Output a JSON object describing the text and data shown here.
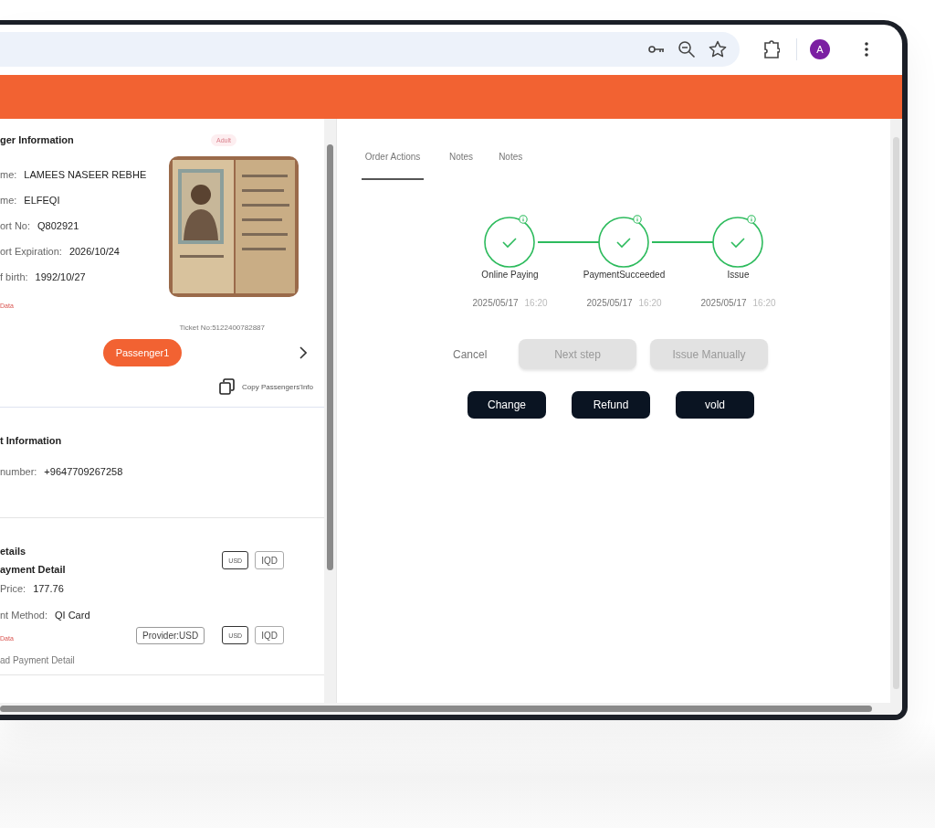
{
  "browser": {
    "avatar": "A"
  },
  "passenger": {
    "title": "ger Information",
    "badge": "Adult",
    "fields": [
      {
        "label": "me:",
        "value": "LAMEES NASEER REBHE"
      },
      {
        "label": "me:",
        "value": "ELFEQI"
      },
      {
        "label": "ort No:",
        "value": "Q802921"
      },
      {
        "label": "ort Expiration:",
        "value": "2026/10/24"
      },
      {
        "label": "f birth:",
        "value": "1992/10/27"
      }
    ],
    "note": "Data",
    "ticket": "Ticket No:5122400782887",
    "button": "Passenger1",
    "copy_label": "Copy Passengers'Info"
  },
  "contact": {
    "title": "t Information",
    "fields": [
      {
        "label": "number:",
        "value": "+9647709267258"
      }
    ]
  },
  "payment": {
    "title": "etails",
    "subtitle": "ayment Detail",
    "currencies": [
      {
        "label": "USD",
        "selected": true
      },
      {
        "label": "IQD",
        "selected": false
      }
    ],
    "fields": [
      {
        "label": "Price:",
        "value": "177.76"
      },
      {
        "label": "nt Method:",
        "value": "QI Card"
      }
    ],
    "note": "Data",
    "provider": "Provider:USD",
    "currencies_2": [
      {
        "label": "USD",
        "selected": true
      },
      {
        "label": "IQD",
        "selected": false
      }
    ],
    "footer": "ad Payment Detail"
  },
  "tabs": [
    {
      "label": "Order Actions",
      "selected": true
    },
    {
      "label": "Notes",
      "selected": false
    },
    {
      "label": "Notes",
      "selected": false
    }
  ],
  "steps": [
    {
      "label": "Online Paying",
      "date": "2025/05/17",
      "time": "16:20",
      "done": true
    },
    {
      "label": "PaymentSucceeded",
      "date": "2025/05/17",
      "time": "16:20",
      "done": true
    },
    {
      "label": "Issue",
      "date": "2025/05/17",
      "time": "16:20",
      "done": true
    }
  ],
  "actions": [
    {
      "label": "Cancel",
      "kind": "link"
    },
    {
      "label": "Next step",
      "kind": "disabled"
    },
    {
      "label": "Issue Manually",
      "kind": "disabled"
    }
  ],
  "actions_2": [
    {
      "label": "Change",
      "kind": "dark"
    },
    {
      "label": "Refund",
      "kind": "dark"
    },
    {
      "label": "vold",
      "kind": "dark"
    }
  ]
}
